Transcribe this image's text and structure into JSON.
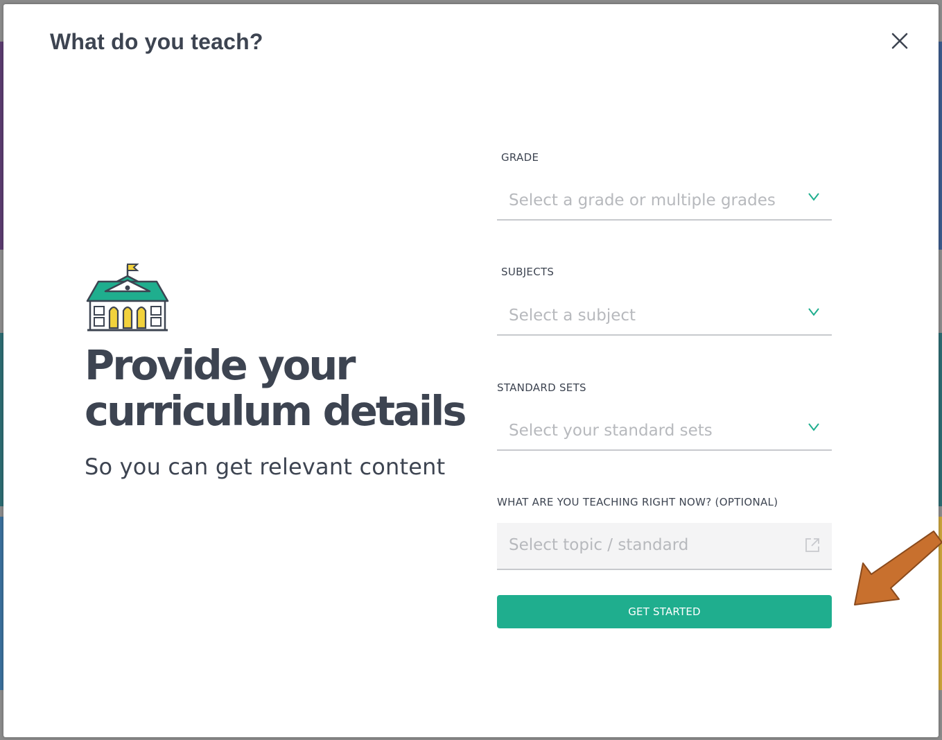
{
  "modal": {
    "title": "What do you teach?",
    "close_icon": "close-icon"
  },
  "promo": {
    "icon": "school-building-icon",
    "headline_line1": "Provide your",
    "headline_line2": "curriculum details",
    "subline": "So you can get relevant content"
  },
  "form": {
    "grade": {
      "label": "GRADE",
      "placeholder": "Select a grade or multiple grades",
      "icon": "chevron-down-icon"
    },
    "subjects": {
      "label": "SUBJECTS",
      "placeholder": "Select a subject",
      "icon": "chevron-down-icon"
    },
    "standard_sets": {
      "label": "STANDARD SETS",
      "placeholder": "Select your standard sets",
      "icon": "chevron-down-icon"
    },
    "teaching_now": {
      "label": "WHAT ARE YOU TEACHING RIGHT NOW? (OPTIONAL)",
      "placeholder": "Select topic / standard",
      "icon": "external-link-icon"
    },
    "submit_label": "GET STARTED"
  },
  "colors": {
    "accent": "#1fae8e",
    "text": "#3d4451",
    "placeholder": "#b7b9bd",
    "annotation_arrow": "#c8702e"
  }
}
